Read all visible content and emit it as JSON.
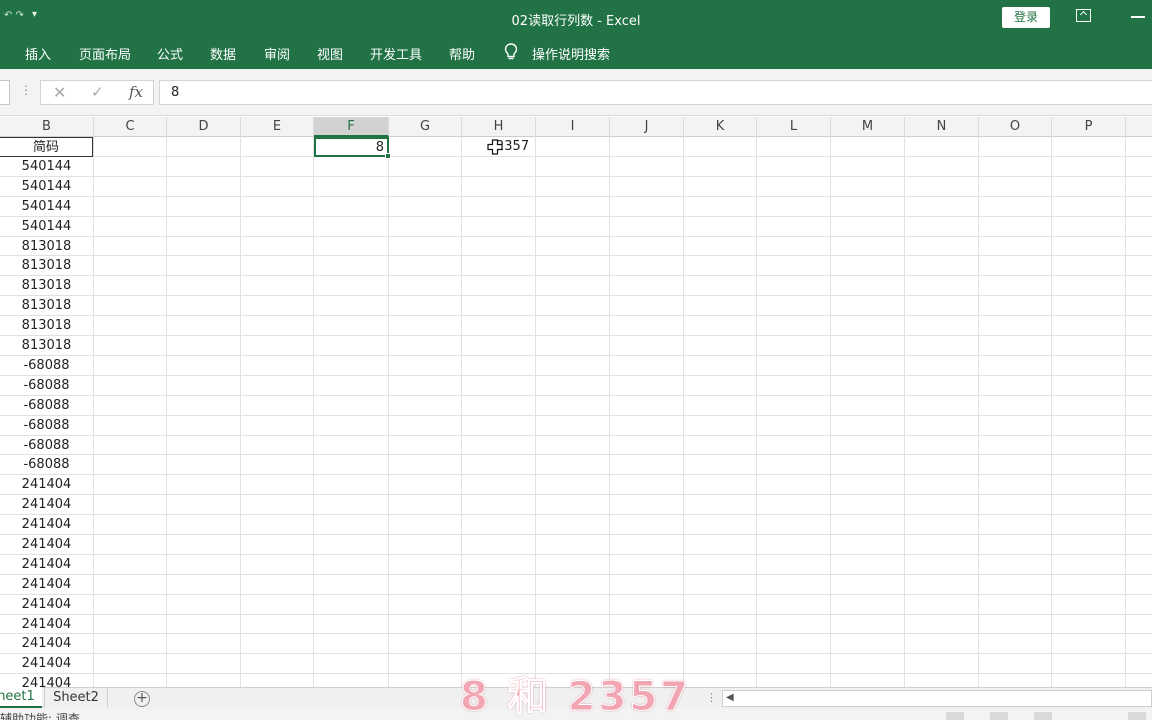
{
  "window": {
    "title": "02读取行列数  -  Excel",
    "login_label": "登录"
  },
  "ribbon": {
    "tabs": [
      "插入",
      "页面布局",
      "公式",
      "数据",
      "审阅",
      "视图",
      "开发工具",
      "帮助"
    ],
    "tell_me": "操作说明搜索"
  },
  "formula_bar": {
    "value": "8"
  },
  "columns": [
    "B",
    "C",
    "D",
    "E",
    "F",
    "G",
    "H",
    "I",
    "J",
    "K",
    "L",
    "M",
    "N",
    "O",
    "P"
  ],
  "selected_column": "F",
  "column_b": [
    "简码",
    "540144",
    "540144",
    "540144",
    "540144",
    "813018",
    "813018",
    "813018",
    "813018",
    "813018",
    "813018",
    "-68088",
    "-68088",
    "-68088",
    "-68088",
    "-68088",
    "-68088",
    "241404",
    "241404",
    "241404",
    "241404",
    "241404",
    "241404",
    "241404",
    "241404",
    "241404",
    "241404",
    "241404"
  ],
  "cell_f1": "8",
  "cell_h1": "2357",
  "sheets": [
    "heet1",
    "Sheet2"
  ],
  "status": "辅助功能: 调查",
  "caption": "8 和 2357"
}
